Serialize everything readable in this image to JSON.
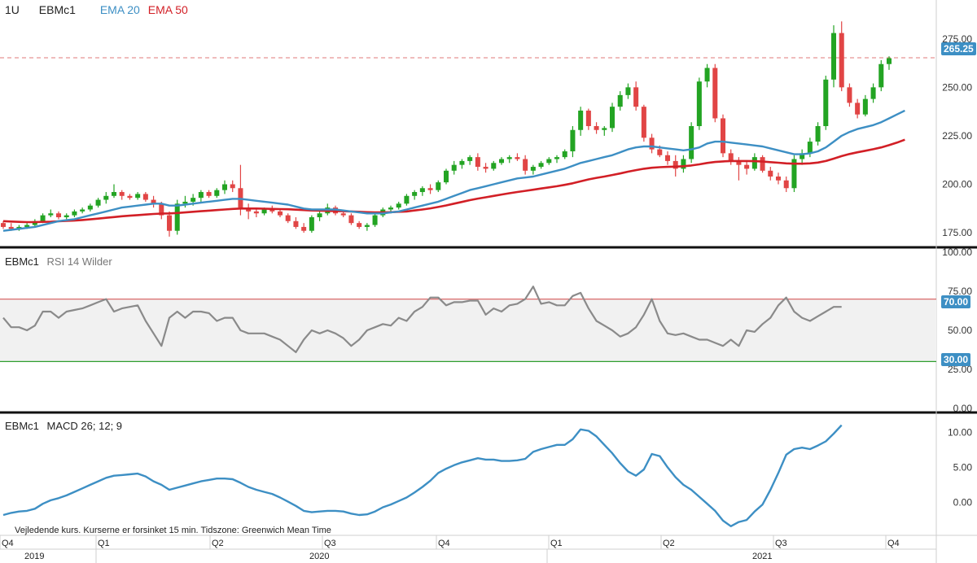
{
  "header": {
    "interval": "1U",
    "symbol": "EBMc1",
    "ema20_label": "EMA 20",
    "ema50_label": "EMA 50"
  },
  "colors": {
    "ema20": "#3d8fc4",
    "ema50": "#d21f26",
    "up": "#23a423",
    "down": "#e14545",
    "rsi": "#8a8a8a",
    "macd": "#3d8fc4",
    "rsi_band": "#f1f1f1",
    "rsi_upper": "#d96b6b",
    "rsi_lower": "#2e9e2e",
    "price_line": "#e07a7a",
    "badge_blue": "#3d8fc4"
  },
  "last_price": "265.25",
  "rsi_header": {
    "symbol": "EBMc1",
    "indicator": "RSI 14 Wilder"
  },
  "rsi_levels": {
    "upper": "70.00",
    "lower": "30.00"
  },
  "macd_header": {
    "symbol": "EBMc1",
    "indicator": "MACD 26; 12; 9"
  },
  "footnote": "Vejledende kurs. Kurserne er forsinket 15 min.    Tidszone: Greenwich Mean Time",
  "quarter_labels": [
    "Q4",
    "Q1",
    "Q2",
    "Q3",
    "Q4",
    "Q1",
    "Q2",
    "Q3",
    "Q4"
  ],
  "year_labels": [
    "2019",
    "2020",
    "2021"
  ],
  "chart_data": [
    {
      "type": "candlestick",
      "title": "1U EBMc1",
      "ylim": [
        170,
        290
      ],
      "yticks": [
        "175.00",
        "200.00",
        "225.00",
        "250.00",
        "275.00"
      ],
      "candles": [
        [
          180,
          181,
          177,
          178
        ],
        [
          178,
          180,
          176,
          177
        ],
        [
          177,
          179,
          176,
          178
        ],
        [
          178,
          180,
          177,
          179
        ],
        [
          179,
          182,
          178,
          181
        ],
        [
          181,
          185,
          180,
          184
        ],
        [
          184,
          187,
          183,
          185
        ],
        [
          185,
          186,
          182,
          183
        ],
        [
          183,
          185,
          182,
          184
        ],
        [
          184,
          187,
          183,
          186
        ],
        [
          186,
          188,
          185,
          187
        ],
        [
          187,
          190,
          186,
          189
        ],
        [
          189,
          193,
          188,
          192
        ],
        [
          192,
          196,
          190,
          194
        ],
        [
          194,
          200,
          193,
          196
        ],
        [
          196,
          197,
          192,
          194
        ],
        [
          194,
          195,
          192,
          193
        ],
        [
          193,
          196,
          192,
          195
        ],
        [
          195,
          196,
          191,
          192
        ],
        [
          192,
          194,
          188,
          190
        ],
        [
          190,
          191,
          182,
          184
        ],
        [
          184,
          186,
          173,
          176
        ],
        [
          176,
          192,
          174,
          190
        ],
        [
          190,
          194,
          188,
          191
        ],
        [
          191,
          195,
          189,
          193
        ],
        [
          193,
          197,
          191,
          196
        ],
        [
          196,
          197,
          193,
          194
        ],
        [
          194,
          198,
          193,
          197
        ],
        [
          197,
          202,
          195,
          200
        ],
        [
          200,
          202,
          196,
          198
        ],
        [
          198,
          210,
          184,
          188
        ],
        [
          188,
          190,
          182,
          186
        ],
        [
          186,
          188,
          183,
          185
        ],
        [
          185,
          188,
          184,
          187
        ],
        [
          187,
          189,
          185,
          186
        ],
        [
          186,
          187,
          183,
          184
        ],
        [
          184,
          185,
          180,
          181
        ],
        [
          181,
          183,
          177,
          178
        ],
        [
          178,
          180,
          175,
          176
        ],
        [
          176,
          184,
          175,
          183
        ],
        [
          183,
          186,
          181,
          185
        ],
        [
          185,
          190,
          184,
          188
        ],
        [
          188,
          189,
          184,
          185
        ],
        [
          185,
          187,
          183,
          184
        ],
        [
          184,
          185,
          179,
          180
        ],
        [
          180,
          181,
          177,
          178
        ],
        [
          178,
          180,
          176,
          179
        ],
        [
          179,
          185,
          178,
          184
        ],
        [
          184,
          188,
          183,
          187
        ],
        [
          187,
          189,
          185,
          188
        ],
        [
          188,
          191,
          187,
          190
        ],
        [
          190,
          195,
          189,
          194
        ],
        [
          194,
          197,
          192,
          196
        ],
        [
          196,
          199,
          194,
          198
        ],
        [
          198,
          200,
          195,
          197
        ],
        [
          197,
          202,
          196,
          201
        ],
        [
          201,
          208,
          200,
          207
        ],
        [
          207,
          212,
          205,
          210
        ],
        [
          210,
          213,
          208,
          212
        ],
        [
          212,
          215,
          210,
          214
        ],
        [
          214,
          216,
          207,
          209
        ],
        [
          209,
          211,
          206,
          208
        ],
        [
          208,
          212,
          207,
          211
        ],
        [
          211,
          214,
          210,
          213
        ],
        [
          213,
          215,
          211,
          214
        ],
        [
          214,
          216,
          212,
          213
        ],
        [
          213,
          215,
          205,
          207
        ],
        [
          207,
          210,
          205,
          209
        ],
        [
          209,
          212,
          208,
          211
        ],
        [
          211,
          214,
          210,
          213
        ],
        [
          213,
          215,
          211,
          214
        ],
        [
          214,
          218,
          213,
          217
        ],
        [
          217,
          230,
          214,
          228
        ],
        [
          228,
          240,
          225,
          238
        ],
        [
          238,
          239,
          228,
          230
        ],
        [
          230,
          232,
          226,
          228
        ],
        [
          228,
          230,
          225,
          229
        ],
        [
          229,
          242,
          227,
          240
        ],
        [
          240,
          248,
          238,
          246
        ],
        [
          246,
          252,
          244,
          250
        ],
        [
          250,
          253,
          238,
          240
        ],
        [
          240,
          241,
          222,
          224
        ],
        [
          224,
          226,
          216,
          218
        ],
        [
          218,
          220,
          214,
          215
        ],
        [
          215,
          217,
          210,
          212
        ],
        [
          212,
          215,
          204,
          208
        ],
        [
          208,
          215,
          206,
          213
        ],
        [
          213,
          232,
          211,
          230
        ],
        [
          230,
          255,
          228,
          253
        ],
        [
          253,
          262,
          250,
          260
        ],
        [
          260,
          262,
          232,
          234
        ],
        [
          234,
          236,
          214,
          216
        ],
        [
          216,
          218,
          210,
          212
        ],
        [
          212,
          214,
          202,
          210
        ],
        [
          210,
          212,
          205,
          208
        ],
        [
          208,
          216,
          207,
          214
        ],
        [
          214,
          215,
          206,
          207
        ],
        [
          207,
          209,
          202,
          204
        ],
        [
          204,
          206,
          200,
          202
        ],
        [
          202,
          204,
          196,
          198
        ],
        [
          198,
          215,
          196,
          213
        ],
        [
          213,
          218,
          210,
          216
        ],
        [
          216,
          224,
          214,
          222
        ],
        [
          222,
          232,
          220,
          230
        ],
        [
          230,
          256,
          228,
          254
        ],
        [
          254,
          282,
          250,
          278
        ],
        [
          278,
          284,
          248,
          250
        ],
        [
          250,
          252,
          240,
          242
        ],
        [
          242,
          244,
          234,
          236
        ],
        [
          236,
          246,
          235,
          244
        ],
        [
          244,
          252,
          242,
          250
        ],
        [
          250,
          264,
          248,
          262
        ],
        [
          262,
          266,
          259,
          265
        ]
      ],
      "series": [
        {
          "name": "EMA 20",
          "values": [
            176,
            176.5,
            177,
            177.5,
            178,
            179,
            180,
            181,
            181.5,
            182,
            183,
            184,
            185,
            186,
            187,
            188,
            188.5,
            189,
            189.5,
            190,
            190,
            189,
            189,
            189.5,
            190,
            190.5,
            191,
            191.5,
            192,
            192.5,
            192.5,
            192,
            191.5,
            191,
            190.5,
            190,
            189.5,
            188.5,
            187.5,
            187,
            187,
            187,
            187,
            186.5,
            186,
            185.5,
            185,
            185,
            185,
            185.5,
            186,
            187,
            188,
            189,
            190,
            191,
            192.5,
            194,
            195.5,
            197,
            198,
            199,
            200,
            201,
            202,
            203,
            203.5,
            204,
            205,
            206,
            207,
            208,
            209.5,
            211,
            212,
            213,
            214,
            215,
            216.5,
            218,
            219,
            219.5,
            219.5,
            219,
            218.5,
            218,
            217.5,
            218,
            219,
            221,
            222,
            222,
            221.5,
            221,
            220.5,
            220,
            219.5,
            218.5,
            217.5,
            216.5,
            215.5,
            215.5,
            216,
            217,
            219,
            222,
            225,
            227,
            228.5,
            229.5,
            230.5,
            232,
            234,
            236,
            238
          ]
        },
        {
          "name": "EMA 50",
          "values": [
            181,
            180.8,
            180.6,
            180.5,
            180.5,
            180.6,
            180.7,
            180.9,
            181.1,
            181.3,
            181.6,
            181.9,
            182.3,
            182.7,
            183.1,
            183.5,
            183.8,
            184.1,
            184.4,
            184.7,
            184.9,
            185,
            185.2,
            185.5,
            185.8,
            186.1,
            186.4,
            186.7,
            187,
            187.3,
            187.5,
            187.5,
            187.5,
            187.4,
            187.3,
            187.2,
            187.1,
            186.9,
            186.7,
            186.5,
            186.4,
            186.3,
            186.2,
            186.1,
            186,
            185.8,
            185.6,
            185.5,
            185.5,
            185.6,
            185.8,
            186,
            186.5,
            187,
            187.6,
            188.3,
            189.1,
            190,
            190.9,
            191.8,
            192.6,
            193.3,
            194,
            194.7,
            195.4,
            196,
            196.6,
            197.2,
            197.8,
            198.4,
            199,
            199.7,
            200.5,
            201.5,
            202.5,
            203.3,
            204,
            204.8,
            205.6,
            206.5,
            207.3,
            208,
            208.5,
            208.8,
            209,
            209.1,
            209.3,
            209.7,
            210.3,
            211,
            211.5,
            211.8,
            212,
            212,
            212,
            211.9,
            211.7,
            211.4,
            211.1,
            210.8,
            210.6,
            210.6,
            210.8,
            211.2,
            212,
            213.2,
            214.5,
            215.6,
            216.5,
            217.3,
            218.1,
            219,
            220.2,
            221.5,
            223
          ]
        }
      ]
    },
    {
      "type": "line",
      "title": "EBMc1 RSI 14 Wilder",
      "ylim": [
        0,
        100
      ],
      "yticks": [
        "0.00",
        "25.00",
        "50.00",
        "75.00",
        "100.00"
      ],
      "reference_lines": [
        70,
        30
      ],
      "series": [
        {
          "name": "RSI 14 Wilder",
          "values": [
            58,
            52,
            52,
            50,
            53,
            62,
            62,
            58,
            62,
            63,
            64,
            66,
            68,
            70,
            62,
            64,
            65,
            66,
            56,
            48,
            40,
            58,
            62,
            58,
            62,
            62,
            61,
            56,
            58,
            58,
            50,
            48,
            48,
            48,
            46,
            44,
            40,
            36,
            44,
            50,
            48,
            50,
            48,
            45,
            40,
            44,
            50,
            52,
            54,
            53,
            58,
            56,
            62,
            65,
            71,
            71,
            66,
            68,
            68,
            69,
            69,
            60,
            64,
            62,
            66,
            67,
            70,
            78,
            67,
            68,
            66,
            66,
            72,
            74,
            64,
            56,
            53,
            50,
            46,
            48,
            52,
            60,
            70,
            56,
            48,
            47,
            48,
            46,
            44,
            44,
            42,
            40,
            44,
            40,
            50,
            49,
            54,
            58,
            66,
            71,
            62,
            58,
            56,
            59,
            62,
            65,
            65
          ]
        }
      ]
    },
    {
      "type": "line",
      "title": "EBMc1 MACD 26; 12; 9",
      "ylim": [
        -4,
        12
      ],
      "yticks": [
        "0.00",
        "5.00",
        "10.00"
      ],
      "series": [
        {
          "name": "MACD 26; 12; 9",
          "values": [
            -1.8,
            -1.5,
            -1.3,
            -1.2,
            -0.9,
            -0.2,
            0.3,
            0.6,
            1,
            1.5,
            2,
            2.5,
            3,
            3.5,
            3.8,
            3.9,
            4,
            4.1,
            3.7,
            3,
            2.5,
            1.8,
            2.1,
            2.4,
            2.7,
            3,
            3.2,
            3.4,
            3.4,
            3.3,
            2.8,
            2.2,
            1.8,
            1.5,
            1.2,
            0.7,
            0.1,
            -0.5,
            -1.2,
            -1.4,
            -1.3,
            -1.2,
            -1.2,
            -1.3,
            -1.6,
            -1.8,
            -1.7,
            -1.3,
            -0.7,
            -0.3,
            0.2,
            0.7,
            1.4,
            2.2,
            3.1,
            4.2,
            4.8,
            5.3,
            5.7,
            6,
            6.3,
            6.1,
            6.1,
            5.9,
            5.9,
            6,
            6.2,
            7.2,
            7.6,
            7.9,
            8.2,
            8.2,
            9,
            10.4,
            10.2,
            9.4,
            8.2,
            7,
            5.6,
            4.4,
            3.8,
            4.7,
            6.9,
            6.6,
            5,
            3.6,
            2.5,
            1.8,
            0.8,
            -0.2,
            -1.2,
            -2.6,
            -3.4,
            -2.8,
            -2.5,
            -1.3,
            -0.3,
            1.8,
            4.2,
            6.8,
            7.6,
            7.8,
            7.6,
            8.1,
            8.7,
            9.8,
            11
          ]
        }
      ]
    }
  ]
}
